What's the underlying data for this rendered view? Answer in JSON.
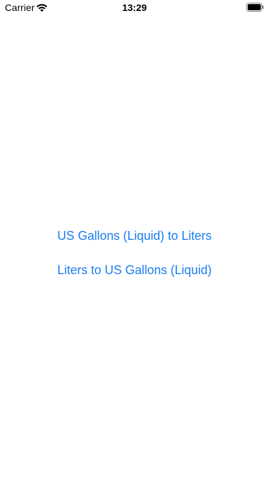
{
  "status_bar": {
    "carrier": "Carrier",
    "time": "13:29",
    "icons": [
      "wifi-icon",
      "battery-icon"
    ]
  },
  "actions": {
    "gallons_to_liters": "US Gallons (Liquid) to Liters",
    "liters_to_gallons": "Liters to US Gallons (Liquid)"
  },
  "colors": {
    "accent": "#1a7cf0",
    "background": "#ffffff",
    "text": "#000000"
  }
}
